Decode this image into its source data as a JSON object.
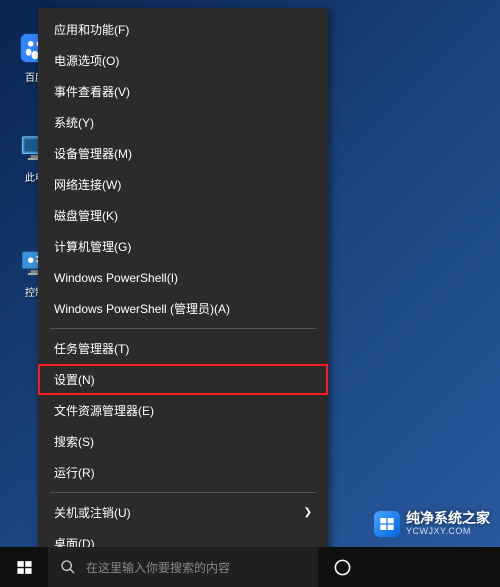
{
  "desktop": {
    "icons": {
      "baidu": "百度",
      "thispc": "此电",
      "control": "控制"
    }
  },
  "menu": {
    "items": [
      {
        "label": "应用和功能(F)"
      },
      {
        "label": "电源选项(O)"
      },
      {
        "label": "事件查看器(V)"
      },
      {
        "label": "系统(Y)"
      },
      {
        "label": "设备管理器(M)"
      },
      {
        "label": "网络连接(W)"
      },
      {
        "label": "磁盘管理(K)"
      },
      {
        "label": "计算机管理(G)"
      },
      {
        "label": "Windows PowerShell(I)"
      },
      {
        "label": "Windows PowerShell (管理员)(A)"
      }
    ],
    "group2": [
      {
        "label": "任务管理器(T)"
      },
      {
        "label": "设置(N)",
        "highlighted": true
      },
      {
        "label": "文件资源管理器(E)"
      },
      {
        "label": "搜索(S)"
      },
      {
        "label": "运行(R)"
      }
    ],
    "group3": [
      {
        "label": "关机或注销(U)",
        "submenu": true
      },
      {
        "label": "桌面(D)"
      }
    ]
  },
  "taskbar": {
    "search_placeholder": "在这里输入你要搜索的内容"
  },
  "watermark": {
    "title": "纯净系统之家",
    "url": "YCWJXY.COM"
  }
}
